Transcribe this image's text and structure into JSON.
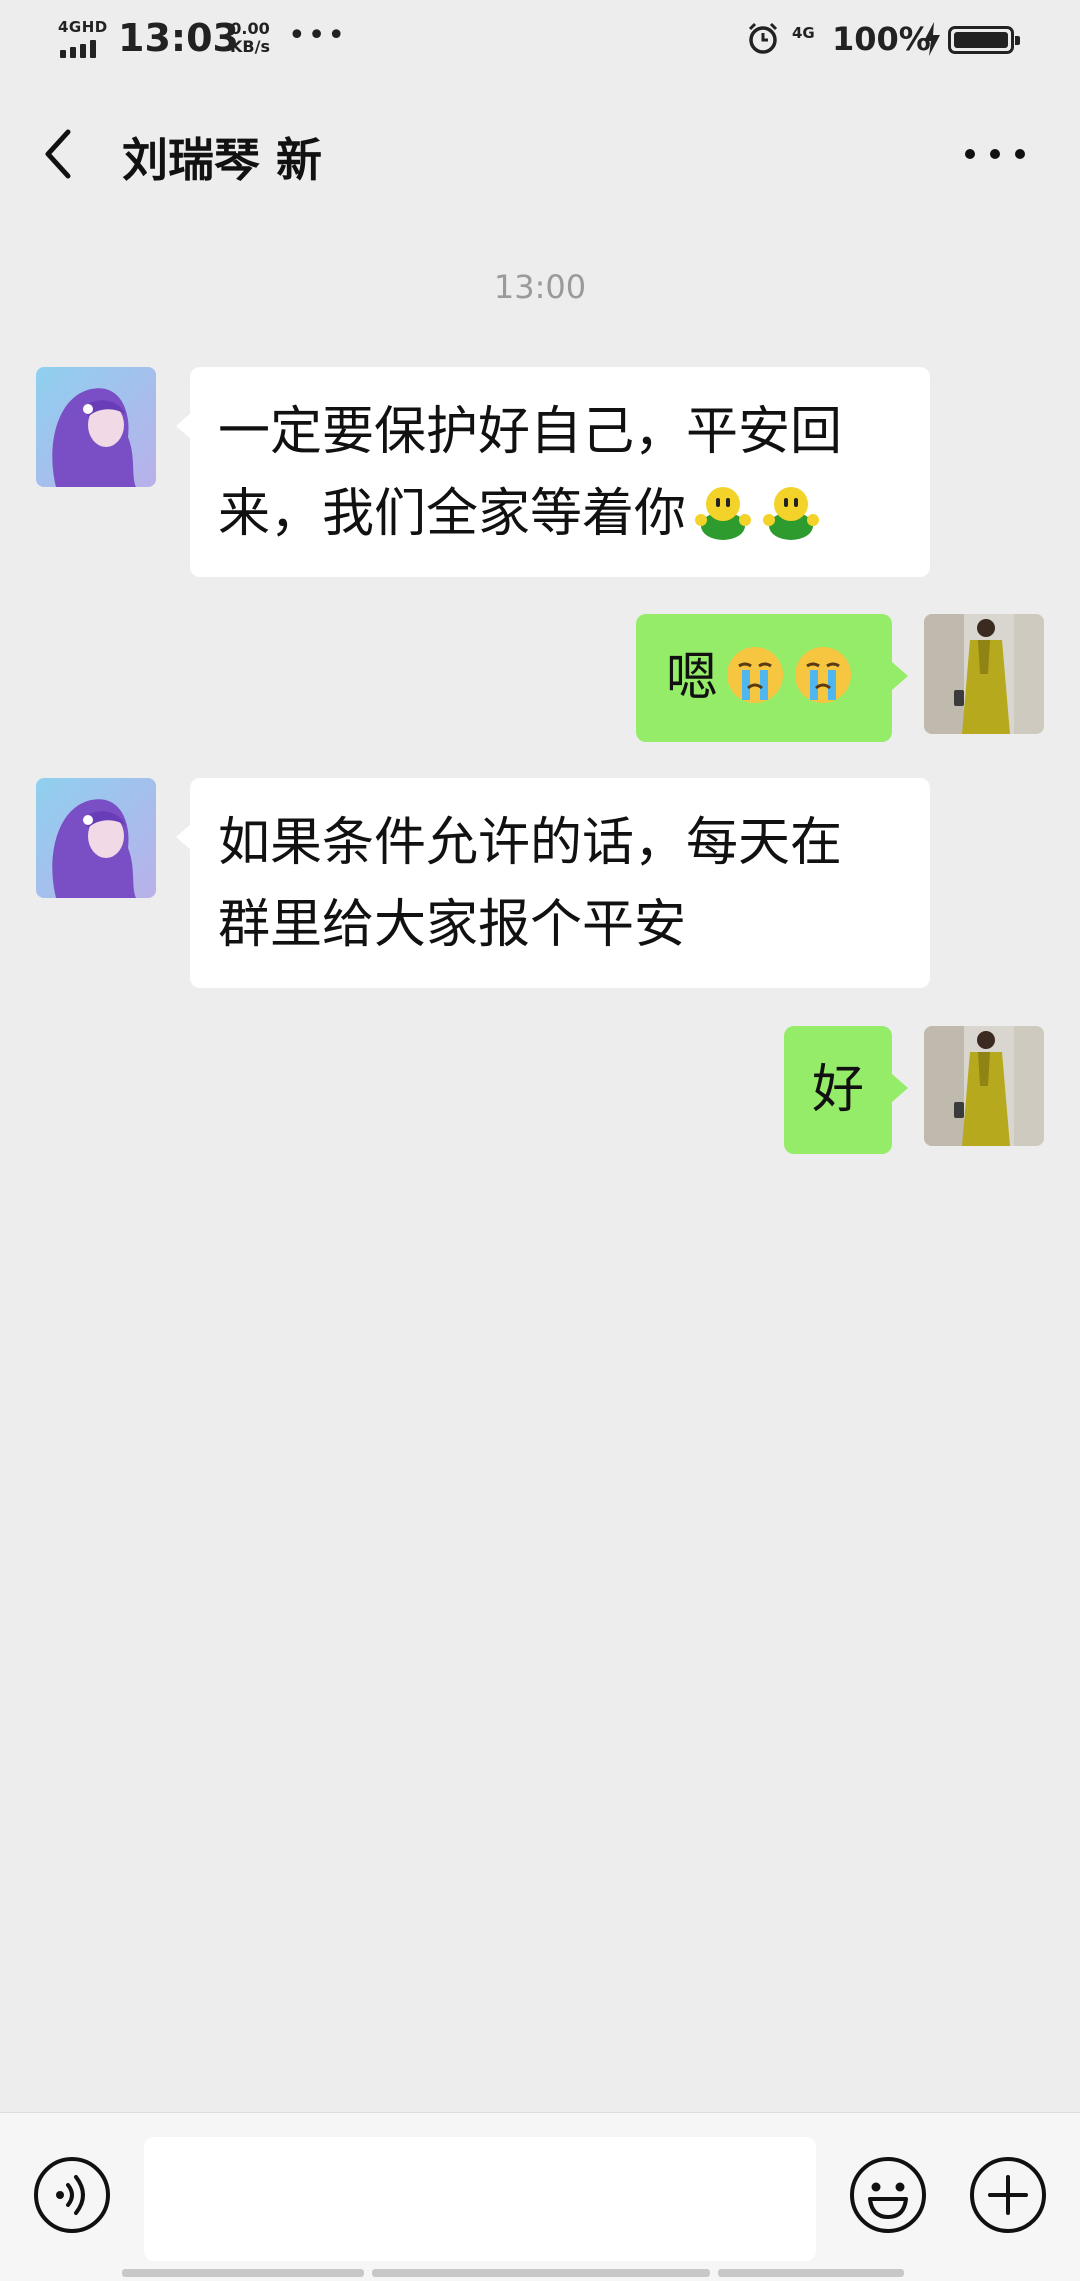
{
  "status_bar": {
    "network": "4GHD",
    "time": "13:03",
    "speed_value": "0.00",
    "speed_unit": "KB/s",
    "network_right": "4G",
    "battery": "100%"
  },
  "header": {
    "title": "刘瑞琴 新"
  },
  "chat": {
    "timestamp": "13:00",
    "messages": [
      {
        "side": "in",
        "line1": "一定要保护好自己，平安回",
        "line2": "来，我们全家等着你"
      },
      {
        "side": "out",
        "text": "嗯"
      },
      {
        "side": "in",
        "line1": "如果条件允许的话，每天在",
        "line2": "群里给大家报个平安"
      },
      {
        "side": "out",
        "text": "好"
      }
    ]
  },
  "input_bar": {
    "value": "",
    "icons": [
      "voice-icon",
      "emoji-icon",
      "plus-icon"
    ]
  },
  "colors": {
    "background": "#ededed",
    "outgoing_bubble": "#95ec69",
    "incoming_bubble": "#ffffff"
  }
}
